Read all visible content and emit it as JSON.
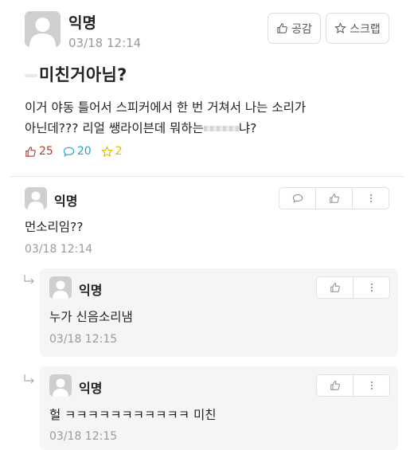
{
  "post": {
    "author": "익명",
    "time": "03/18 12:14",
    "like_button_label": "공감",
    "scrap_button_label": "스크랩",
    "title": "미친거아님?",
    "body_line1": "이거 야동 틀어서 스피커에서 한 번 거쳐서 나는 소리가",
    "body_line2_before": "아닌데??? 리얼 쌩라이븐데 뭐하는",
    "body_line2_after": "냐?",
    "like_count": "25",
    "comment_count": "20",
    "scrap_count": "2"
  },
  "comments": [
    {
      "author": "익명",
      "text": "먼소리임??",
      "time": "03/18 12:14"
    }
  ],
  "replies": [
    {
      "author": "익명",
      "text": "누가 신음소리냄",
      "time": "03/18 12:15"
    },
    {
      "author": "익명",
      "text": "헐 ㅋㅋㅋㅋㅋㅋㅋㅋㅋㅋㅋ 미친",
      "time": "03/18 12:15"
    }
  ],
  "colors": {
    "like": "#c0392b",
    "comment": "#2aa3c2",
    "scrap": "#e6b800",
    "time": "#9a9a9a"
  },
  "icons": {
    "like": "thumbs-up-icon",
    "comment": "speech-bubble-icon",
    "scrap": "star-icon",
    "more": "vertical-dots-icon",
    "reply": "reply-arrow-icon",
    "avatar": "default-user-icon"
  }
}
